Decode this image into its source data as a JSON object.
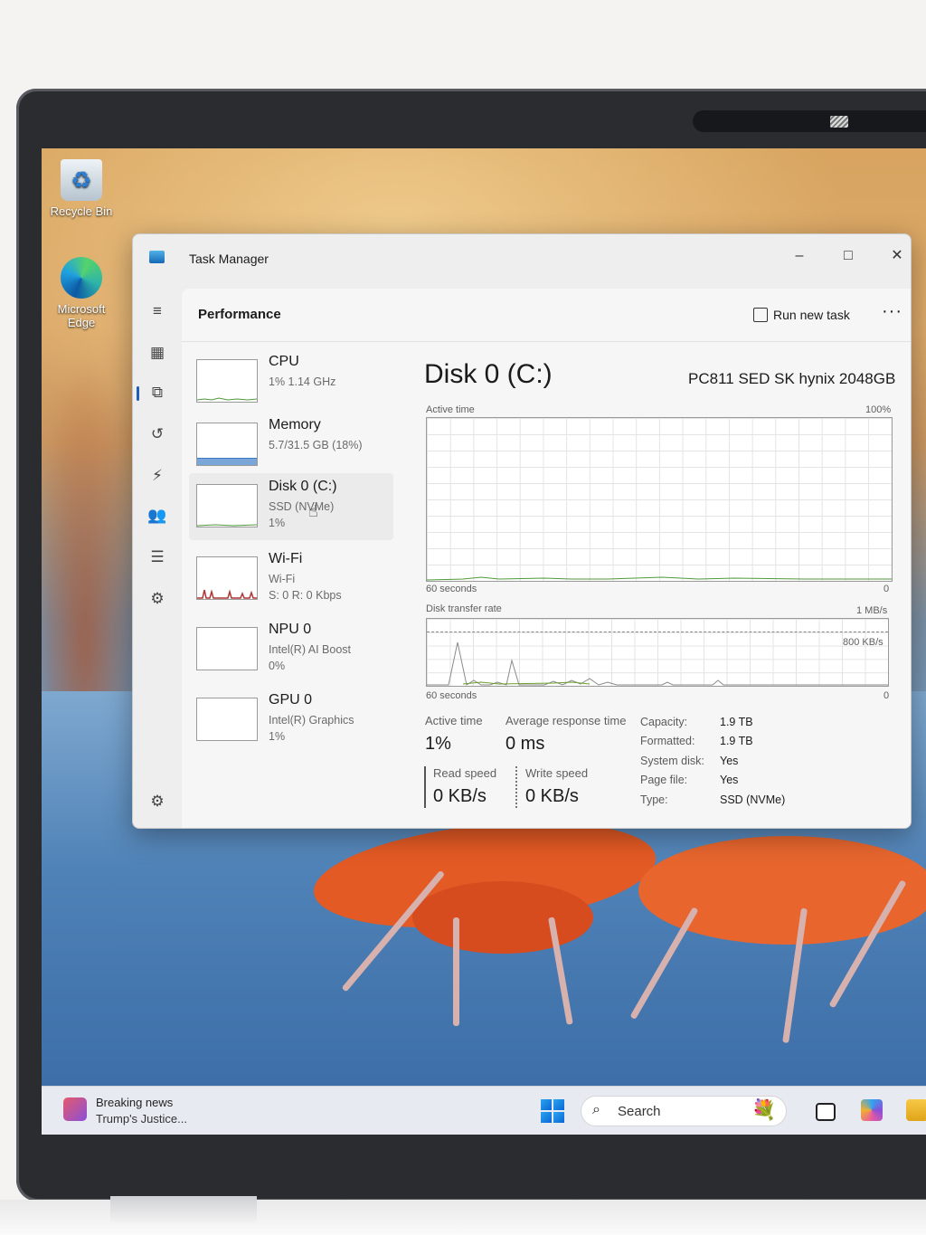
{
  "desktop": {
    "icons": [
      {
        "label": "Recycle Bin"
      },
      {
        "label": "Microsoft Edge"
      }
    ]
  },
  "window": {
    "title": "Task Manager",
    "controls": {
      "minimize": "–",
      "maximize": "□",
      "close": "✕"
    }
  },
  "header": {
    "page": "Performance",
    "run_new_task": "Run new task",
    "more": "···"
  },
  "nav": [
    "menu-icon",
    "processes-icon",
    "performance-icon",
    "app-history-icon",
    "startup-apps-icon",
    "users-icon",
    "details-icon",
    "services-icon",
    "settings-icon"
  ],
  "devices": [
    {
      "name": "CPU",
      "sub": [
        "1%  1.14 GHz"
      ],
      "selected": false
    },
    {
      "name": "Memory",
      "sub": [
        "5.7/31.5 GB (18%)"
      ],
      "selected": false
    },
    {
      "name": "Disk 0 (C:)",
      "sub": [
        "SSD (NVMe)",
        "1%"
      ],
      "selected": true
    },
    {
      "name": "Wi-Fi",
      "sub": [
        "Wi-Fi",
        "S: 0  R: 0 Kbps"
      ],
      "selected": false
    },
    {
      "name": "NPU 0",
      "sub": [
        "Intel(R) AI Boost",
        "0%"
      ],
      "selected": false
    },
    {
      "name": "GPU 0",
      "sub": [
        "Intel(R) Graphics",
        "1%"
      ],
      "selected": false
    }
  ],
  "detail": {
    "title": "Disk 0 (C:)",
    "model": "PC811 SED SK hynix 2048GB",
    "graph1": {
      "label": "Active time",
      "max": "100%",
      "time": "60 seconds",
      "min": "0"
    },
    "graph2": {
      "label": "Disk transfer rate",
      "max": "1 MB/s",
      "inner": "800 KB/s",
      "time": "60 seconds",
      "min": "0"
    },
    "stats": {
      "active_time_label": "Active time",
      "active_time_value": "1%",
      "avg_response_label": "Average response time",
      "avg_response_value": "0 ms",
      "read_label": "Read speed",
      "read_value": "0 KB/s",
      "write_label": "Write speed",
      "write_value": "0 KB/s"
    },
    "props": [
      {
        "key": "Capacity:",
        "val": "1.9 TB"
      },
      {
        "key": "Formatted:",
        "val": "1.9 TB"
      },
      {
        "key": "System disk:",
        "val": "Yes"
      },
      {
        "key": "Page file:",
        "val": "Yes"
      },
      {
        "key": "Type:",
        "val": "SSD (NVMe)"
      }
    ]
  },
  "taskbar": {
    "news_line1": "Breaking news",
    "news_line2": "Trump's Justice...",
    "search_placeholder": "Search"
  },
  "colors": {
    "disk_line": "#4e9a3a",
    "accent": "#1d5fb8",
    "wifi_spikes": "#b03434",
    "memory_fill": "#7aa6d8"
  }
}
